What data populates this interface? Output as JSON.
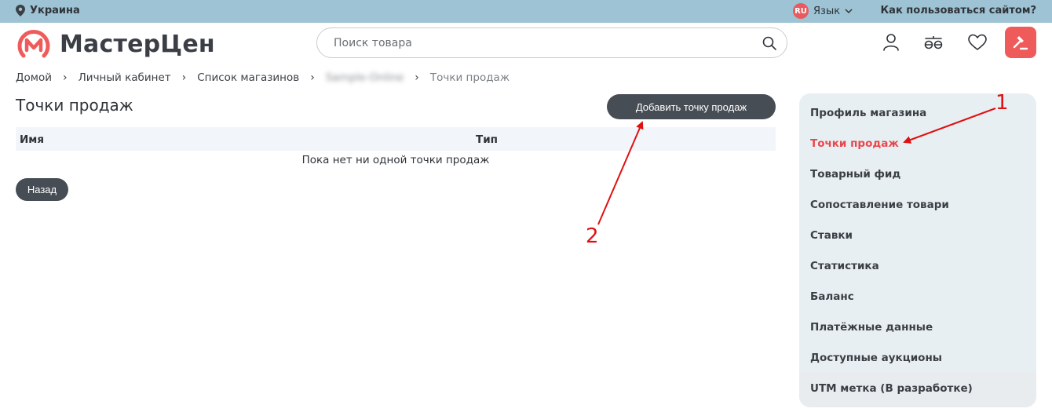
{
  "topbar": {
    "region": "Украина",
    "lang_code": "RU",
    "lang_label": "Язык",
    "howto": "Как пользоваться сайтом?"
  },
  "header": {
    "logo_text": "МастерЦен",
    "search_placeholder": "Поиск товара"
  },
  "breadcrumb": {
    "items": [
      "Домой",
      "Личный кабинет",
      "Список магазинов",
      "Sample-Online",
      "Точки продаж"
    ]
  },
  "main": {
    "title": "Точки продаж",
    "add_button": "Добавить точку продаж",
    "table": {
      "columns": [
        "Имя",
        "Тип"
      ],
      "empty_text": "Пока нет ни одной точки продаж"
    },
    "back_button": "Назад"
  },
  "sidebar": {
    "items": [
      {
        "label": "Профиль магазина",
        "active": false
      },
      {
        "label": "Точки продаж",
        "active": true
      },
      {
        "label": "Товарный фид",
        "active": false
      },
      {
        "label": "Сопоставление товари",
        "active": false
      },
      {
        "label": "Ставки",
        "active": false
      },
      {
        "label": "Статистика",
        "active": false
      },
      {
        "label": "Баланс",
        "active": false
      },
      {
        "label": "Платёжные данные",
        "active": false
      },
      {
        "label": "Доступные аукционы",
        "active": false
      },
      {
        "label": "UTM метка (В разработке)",
        "active": false
      }
    ]
  },
  "annotations": {
    "marker_1": "1",
    "marker_2": "2"
  },
  "colors": {
    "topbar_bg": "#9dc3d4",
    "brand_red": "#e8474b",
    "button_dark": "#474d55",
    "sidebar_bg": "#e8eff3",
    "annotation_red": "#e01010"
  }
}
